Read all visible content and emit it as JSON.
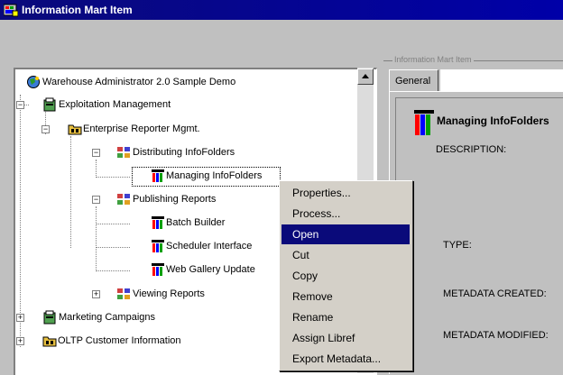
{
  "window": {
    "title": "Information Mart Item"
  },
  "tree": {
    "root": "Warehouse Administrator 2.0 Sample Demo",
    "nodes": [
      "Exploitation Management",
      "Enterprise Reporter Mgmt.",
      "Distributing InfoFolders",
      "Managing InfoFolders",
      "Publishing Reports",
      "Batch Builder",
      "Scheduler Interface",
      "Web Gallery Update",
      "Viewing Reports",
      "Marketing Campaigns",
      "OLTP Customer Information"
    ]
  },
  "details": {
    "group_title": "Information Mart Item",
    "tab": "General",
    "item_name": "Managing InfoFolders",
    "labels": {
      "description": "DESCRIPTION:",
      "type": "TYPE:",
      "created": "METADATA CREATED:",
      "modified": "METADATA MODIFIED:"
    }
  },
  "context_menu": {
    "items": [
      "Properties...",
      "Process...",
      "Open",
      "Cut",
      "Copy",
      "Remove",
      "Rename",
      "Assign Libref",
      "Export Metadata..."
    ],
    "highlighted": "Open"
  },
  "colors": {
    "titlebar": "#0a0a7a",
    "highlight": "#0a0a7a",
    "face": "#c0c0c0"
  }
}
